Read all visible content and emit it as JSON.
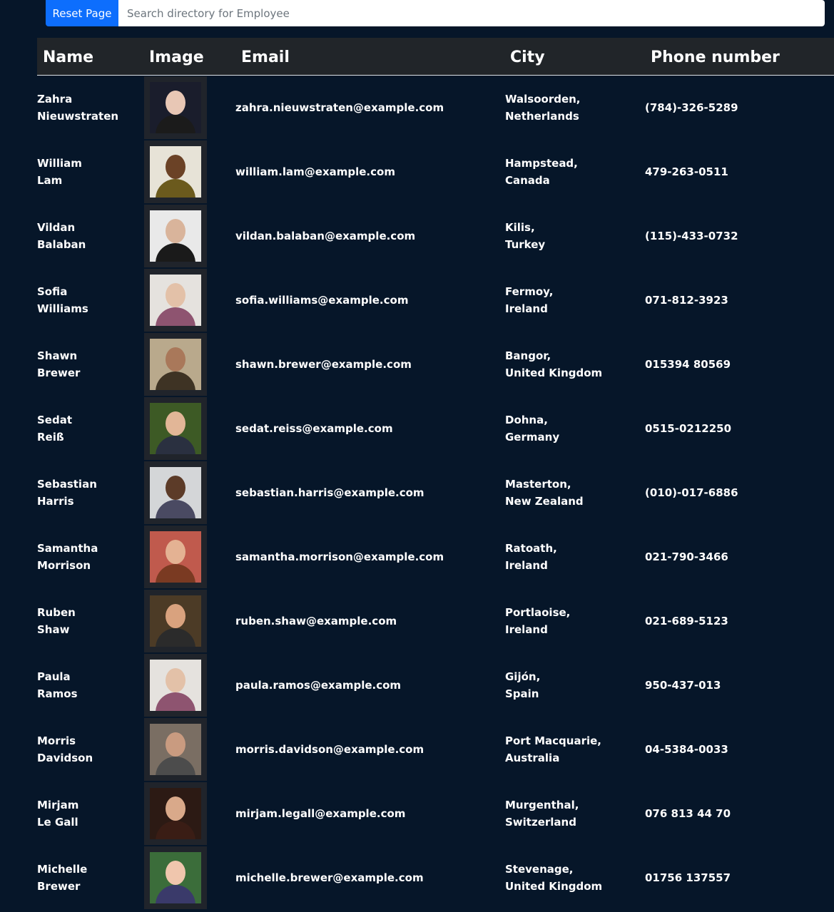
{
  "toolbar": {
    "reset_label": "Reset Page",
    "search_placeholder": "Search directory for Employee",
    "search_value": ""
  },
  "table": {
    "headers": {
      "name": "Name",
      "image": "Image",
      "email": "Email",
      "city": "City",
      "phone": "Phone number"
    },
    "rows": [
      {
        "first": "Zahra",
        "last": "Nieuwstraten",
        "email": "zahra.nieuwstraten@example.com",
        "city": "Walsoorden,",
        "country": "Netherlands",
        "phone": "(784)-326-5289",
        "photo_bg": "#1a1d2c",
        "skin": "#e8c7b5",
        "clothes": "#1b1b1b"
      },
      {
        "first": "William",
        "last": "Lam",
        "email": "william.lam@example.com",
        "city": "Hampstead,",
        "country": "Canada",
        "phone": "479-263-0511",
        "photo_bg": "#e7e3d7",
        "skin": "#6b4226",
        "clothes": "#6b5a1d"
      },
      {
        "first": "Vildan",
        "last": "Balaban",
        "email": "vildan.balaban@example.com",
        "city": "Kilis,",
        "country": "Turkey",
        "phone": "(115)-433-0732",
        "photo_bg": "#e9e9e9",
        "skin": "#d9b49b",
        "clothes": "#1a1a1a"
      },
      {
        "first": "Sofia",
        "last": "Williams",
        "email": "sofia.williams@example.com",
        "city": "Fermoy,",
        "country": "Ireland",
        "phone": "071-812-3923",
        "photo_bg": "#e5e2de",
        "skin": "#e3c1a8",
        "clothes": "#8e5470"
      },
      {
        "first": "Shawn",
        "last": "Brewer",
        "email": "shawn.brewer@example.com",
        "city": "Bangor,",
        "country": "United Kingdom",
        "phone": "015394 80569",
        "photo_bg": "#b9a98c",
        "skin": "#a9785a",
        "clothes": "#3e3324"
      },
      {
        "first": "Sedat",
        "last": "Reiß",
        "email": "sedat.reiss@example.com",
        "city": "Dohna,",
        "country": "Germany",
        "phone": "0515-0212250",
        "photo_bg": "#3d5a25",
        "skin": "#e2b697",
        "clothes": "#2a3040"
      },
      {
        "first": "Sebastian",
        "last": "Harris",
        "email": "sebastian.harris@example.com",
        "city": "Masterton,",
        "country": "New Zealand",
        "phone": "(010)-017-6886",
        "photo_bg": "#d4d6d8",
        "skin": "#5c3b28",
        "clothes": "#4a4a62"
      },
      {
        "first": "Samantha",
        "last": "Morrison",
        "email": "samantha.morrison@example.com",
        "city": "Ratoath,",
        "country": "Ireland",
        "phone": "021-790-3466",
        "photo_bg": "#c05a4d",
        "skin": "#e4b293",
        "clothes": "#7a3a22"
      },
      {
        "first": "Ruben",
        "last": "Shaw",
        "email": "ruben.shaw@example.com",
        "city": "Portlaoise,",
        "country": "Ireland",
        "phone": "021-689-5123",
        "photo_bg": "#4c3b26",
        "skin": "#d9a27e",
        "clothes": "#2b2b2b"
      },
      {
        "first": "Paula",
        "last": "Ramos",
        "email": "paula.ramos@example.com",
        "city": "Gijón,",
        "country": "Spain",
        "phone": "950-437-013",
        "photo_bg": "#e5e2de",
        "skin": "#e3c1a8",
        "clothes": "#8e5470"
      },
      {
        "first": "Morris",
        "last": "Davidson",
        "email": "morris.davidson@example.com",
        "city": "Port Macquarie,",
        "country": "Australia",
        "phone": "04-5384-0033",
        "photo_bg": "#7a6e63",
        "skin": "#c99b80",
        "clothes": "#4c4c4c"
      },
      {
        "first": "Mirjam",
        "last": "Le Gall",
        "email": "mirjam.legall@example.com",
        "city": "Murgenthal,",
        "country": "Switzerland",
        "phone": "076 813 44 70",
        "photo_bg": "#2c1a14",
        "skin": "#d9a98a",
        "clothes": "#3a1d15"
      },
      {
        "first": "Michelle",
        "last": "Brewer",
        "email": "michelle.brewer@example.com",
        "city": "Stevenage,",
        "country": "United Kingdom",
        "phone": "01756 137557",
        "photo_bg": "#3b6d3a",
        "skin": "#f0c6ad",
        "clothes": "#3a3a6a"
      }
    ]
  }
}
